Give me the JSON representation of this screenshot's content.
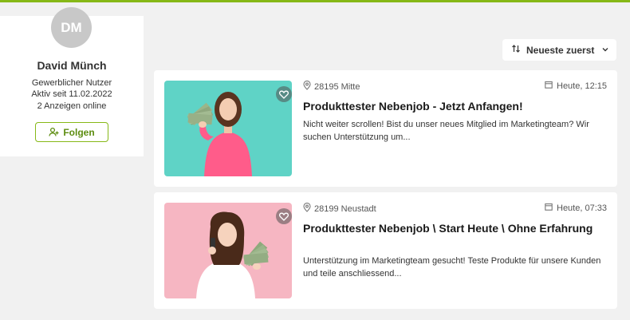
{
  "colors": {
    "accent": "#86b817",
    "background": "#f1f1f1"
  },
  "profile": {
    "initials": "DM",
    "name": "David Münch",
    "user_type": "Gewerblicher Nutzer",
    "active_since": "Aktiv seit 11.02.2022",
    "ads_online": "2 Anzeigen online",
    "follow_label": "Folgen",
    "follow_icon": "follow-user-icon"
  },
  "sort": {
    "label": "Neueste zuerst",
    "icon": "sort-arrows-icon"
  },
  "ads": [
    {
      "location": "28195 Mitte",
      "date": "Heute, 12:15",
      "title": "Produkttester Nebenjob - Jetzt Anfangen!",
      "description": "Nicht weiter scrollen! Bist du unser neues Mitglied im Marketingteam? Wir suchen Unterstützung um...",
      "image": "woman-holding-cash-photo"
    },
    {
      "location": "28199 Neustadt",
      "date": "Heute, 07:33",
      "title": "Produkttester Nebenjob \\ Start Heute \\ Ohne Erfahrung",
      "description": "Unterstützung im Marketingteam gesucht! Teste Produkte für unsere Kunden und teile anschliessend...",
      "image": "woman-phone-cash-photo"
    }
  ]
}
